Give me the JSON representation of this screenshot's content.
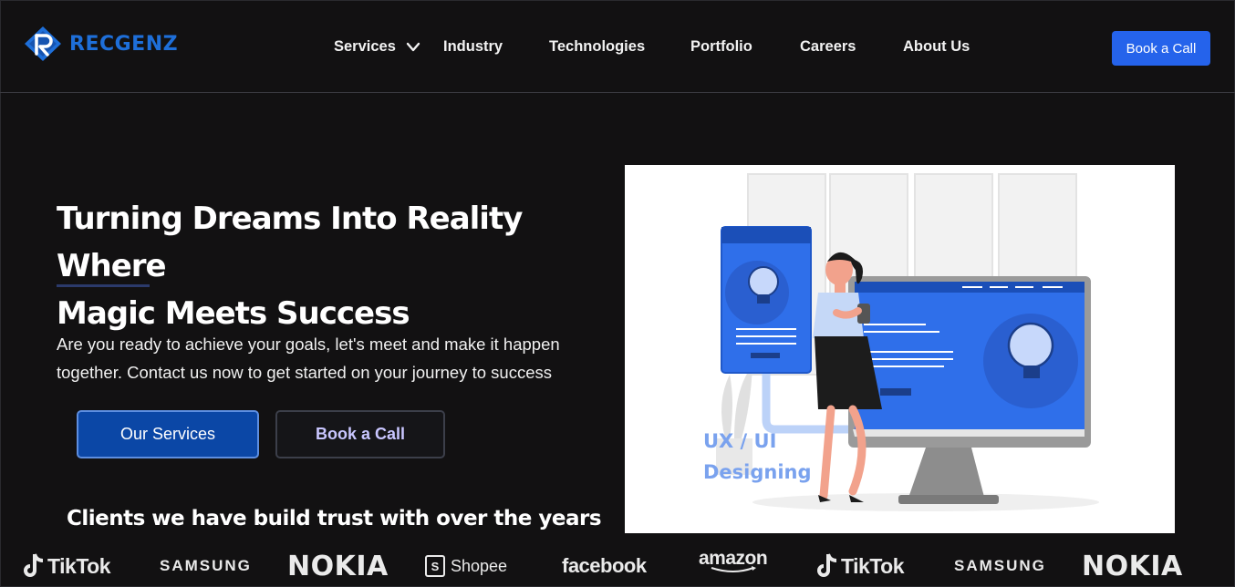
{
  "header": {
    "logo_text": "RECGENZ",
    "nav": [
      {
        "label": "Services",
        "has_dropdown": true
      },
      {
        "label": "Industry"
      },
      {
        "label": "Technologies"
      },
      {
        "label": "Portfolio"
      },
      {
        "label": "Careers"
      },
      {
        "label": "About Us"
      }
    ],
    "cta_label": "Book a Call"
  },
  "hero": {
    "headline_line1": "Turning Dreams Into Reality Where",
    "headline_line2": "Magic Meets Success",
    "subtext_line1": "Are you ready to achieve your goals, let's meet and make it happen",
    "subtext_line2": "together. Contact us now to get started on your journey to success",
    "primary_button": "Our Services",
    "secondary_button": "Book a Call",
    "illustration_caption_line1": "UX / UI",
    "illustration_caption_line2": "Designing"
  },
  "clients": {
    "title": "Clients we have build trust with over the years",
    "logos": [
      "TikTok",
      "SAMSUNG",
      "NOKIA",
      "Shopee",
      "facebook",
      "amazon",
      "TikTok",
      "SAMSUNG",
      "NOKIA"
    ]
  },
  "colors": {
    "background": "#121112",
    "brand_blue": "#1e6fd9",
    "cta_blue": "#2563eb",
    "primary_button": "#0b47a6",
    "illustration_blue": "#2f6fea"
  }
}
